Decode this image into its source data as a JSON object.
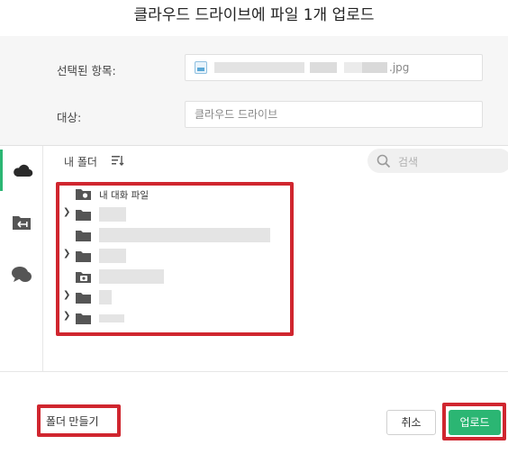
{
  "dialog": {
    "title": "클라우드 드라이브에 파일 1개 업로드"
  },
  "form": {
    "selected_label": "선택된 항목:",
    "selected_value_suffix": ".jpg",
    "target_label": "대상:",
    "target_value": "클라우드 드라이브"
  },
  "sidebar": {
    "items": [
      {
        "name": "cloud-icon"
      },
      {
        "name": "transfer-folder-icon"
      },
      {
        "name": "chat-icon"
      }
    ]
  },
  "browser": {
    "folder_label": "내 폴더",
    "search_placeholder": "검색",
    "rows": [
      {
        "name": "내 대화 파일",
        "icon": "chat-folder-icon",
        "expandable": false
      },
      {
        "name": "",
        "icon": "folder-icon",
        "expandable": true
      },
      {
        "name": "",
        "icon": "folder-icon",
        "expandable": false
      },
      {
        "name": "",
        "icon": "folder-icon",
        "expandable": true
      },
      {
        "name": "",
        "icon": "camera-folder-icon",
        "expandable": false
      },
      {
        "name": "",
        "icon": "folder-icon",
        "expandable": true
      },
      {
        "name": "",
        "icon": "folder-icon",
        "expandable": true
      }
    ]
  },
  "footer": {
    "new_folder_label": "폴더 만들기",
    "cancel_label": "취소",
    "upload_label": "업로드"
  },
  "colors": {
    "accent": "#2bb673",
    "highlight": "#d0262f"
  }
}
